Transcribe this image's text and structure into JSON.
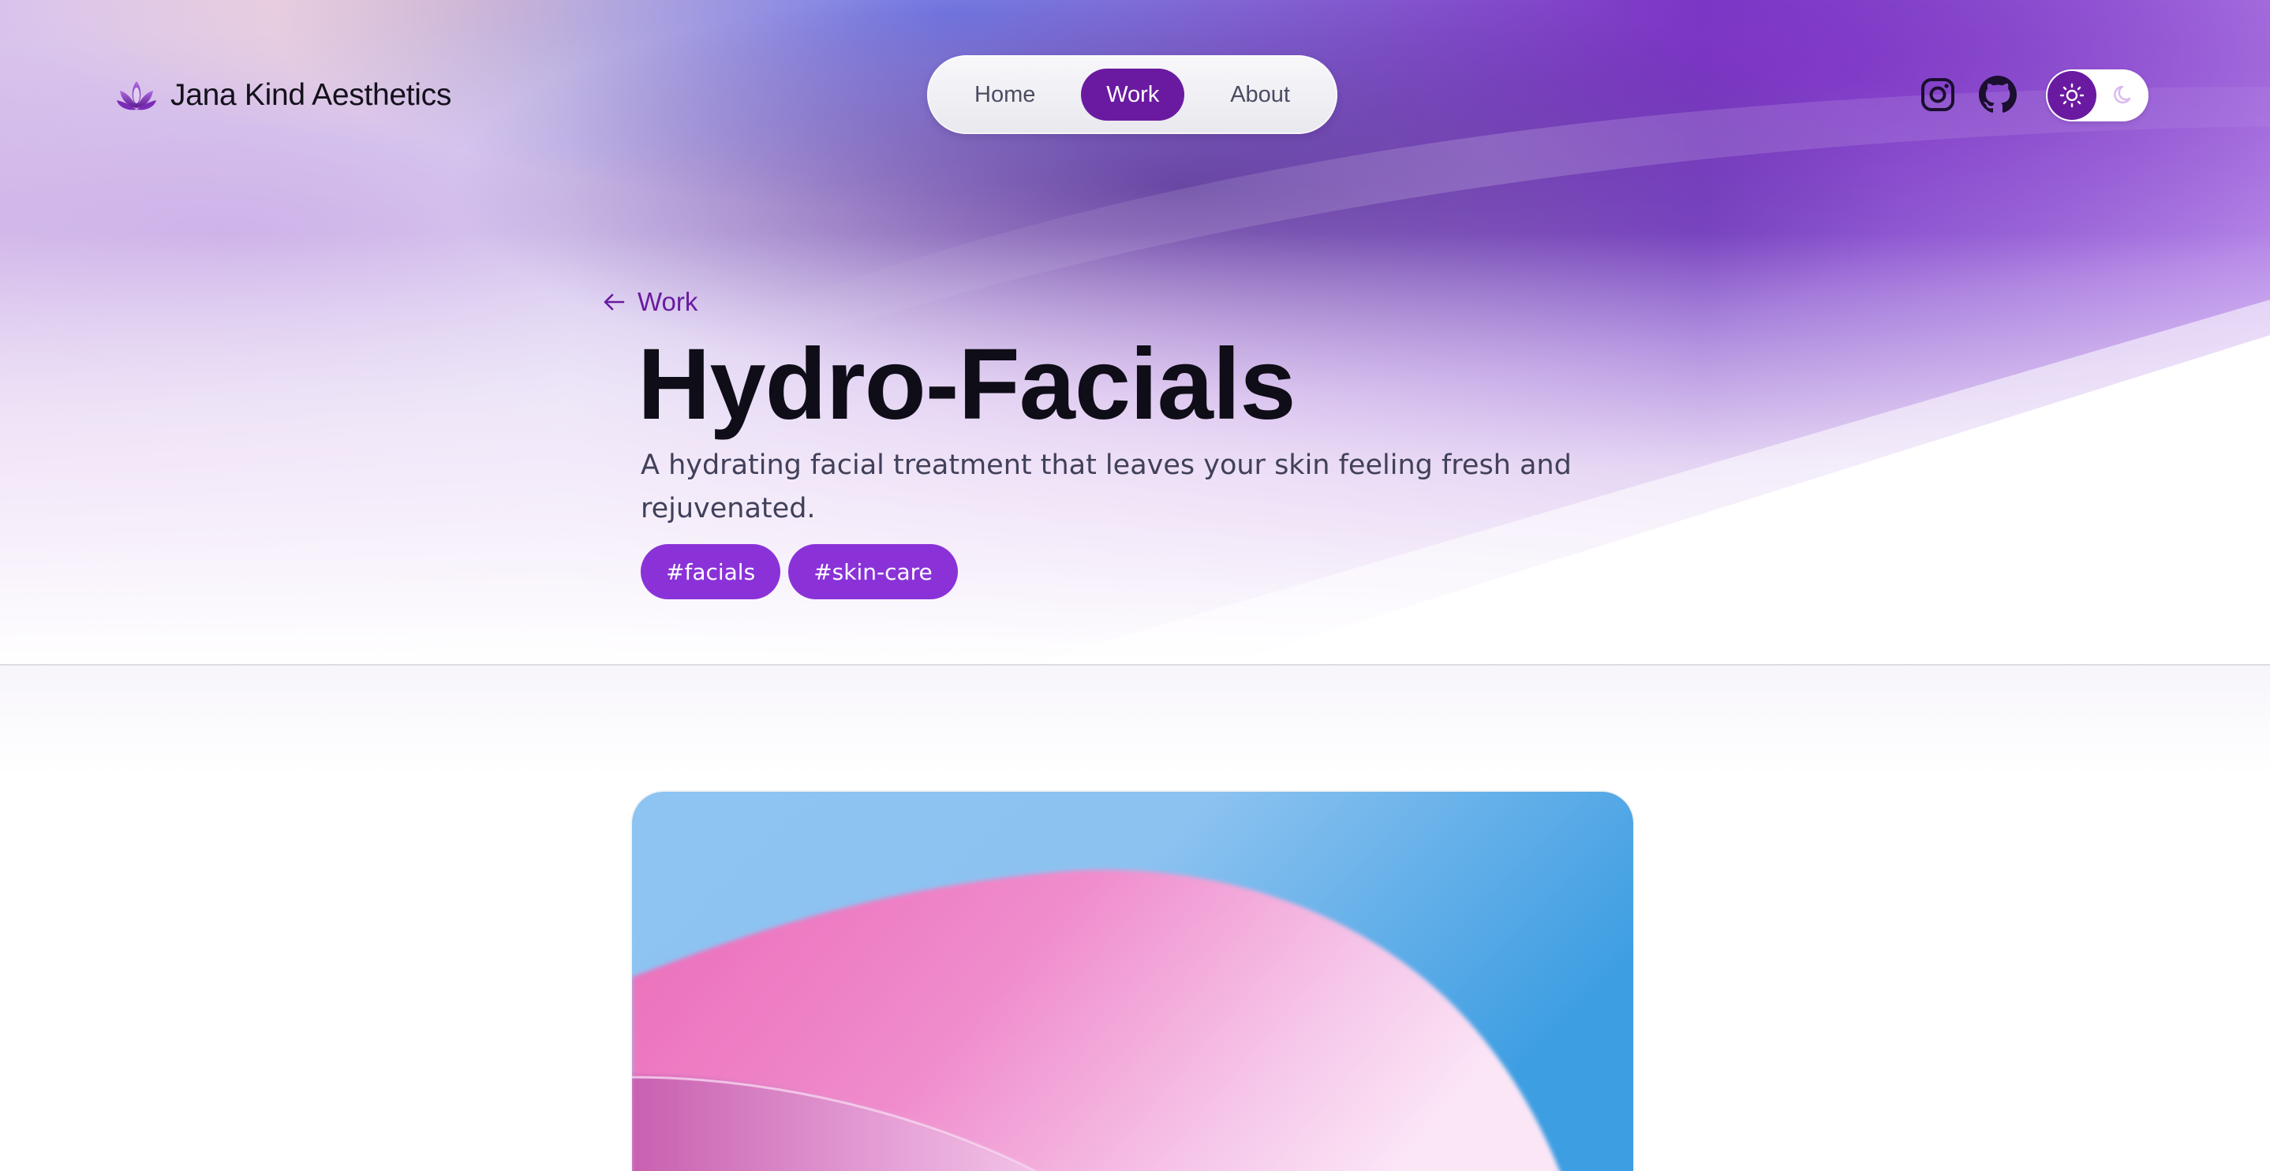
{
  "brand": {
    "name": "Jana Kind Aesthetics",
    "logo_icon": "lotus-icon"
  },
  "nav": {
    "items": [
      {
        "label": "Home",
        "active": false
      },
      {
        "label": "Work",
        "active": true
      },
      {
        "label": "About",
        "active": false
      }
    ]
  },
  "header_actions": {
    "instagram_icon": "instagram-icon",
    "github_icon": "github-icon",
    "theme_toggle": {
      "selected": "light",
      "light_icon": "sun-icon",
      "dark_icon": "moon-icon"
    }
  },
  "breadcrumb": {
    "back_label": "Work",
    "back_icon": "arrow-left-icon"
  },
  "article": {
    "title": "Hydro-Facials",
    "description": "A hydrating facial treatment that leaves your skin feeling fresh and rejuvenated.",
    "tags": [
      "#facials",
      "#skin-care"
    ]
  },
  "colors": {
    "accent": "#6a1aa0",
    "tag": "#8a32d8",
    "title": "#0f0d17",
    "body_text": "#41405a"
  }
}
